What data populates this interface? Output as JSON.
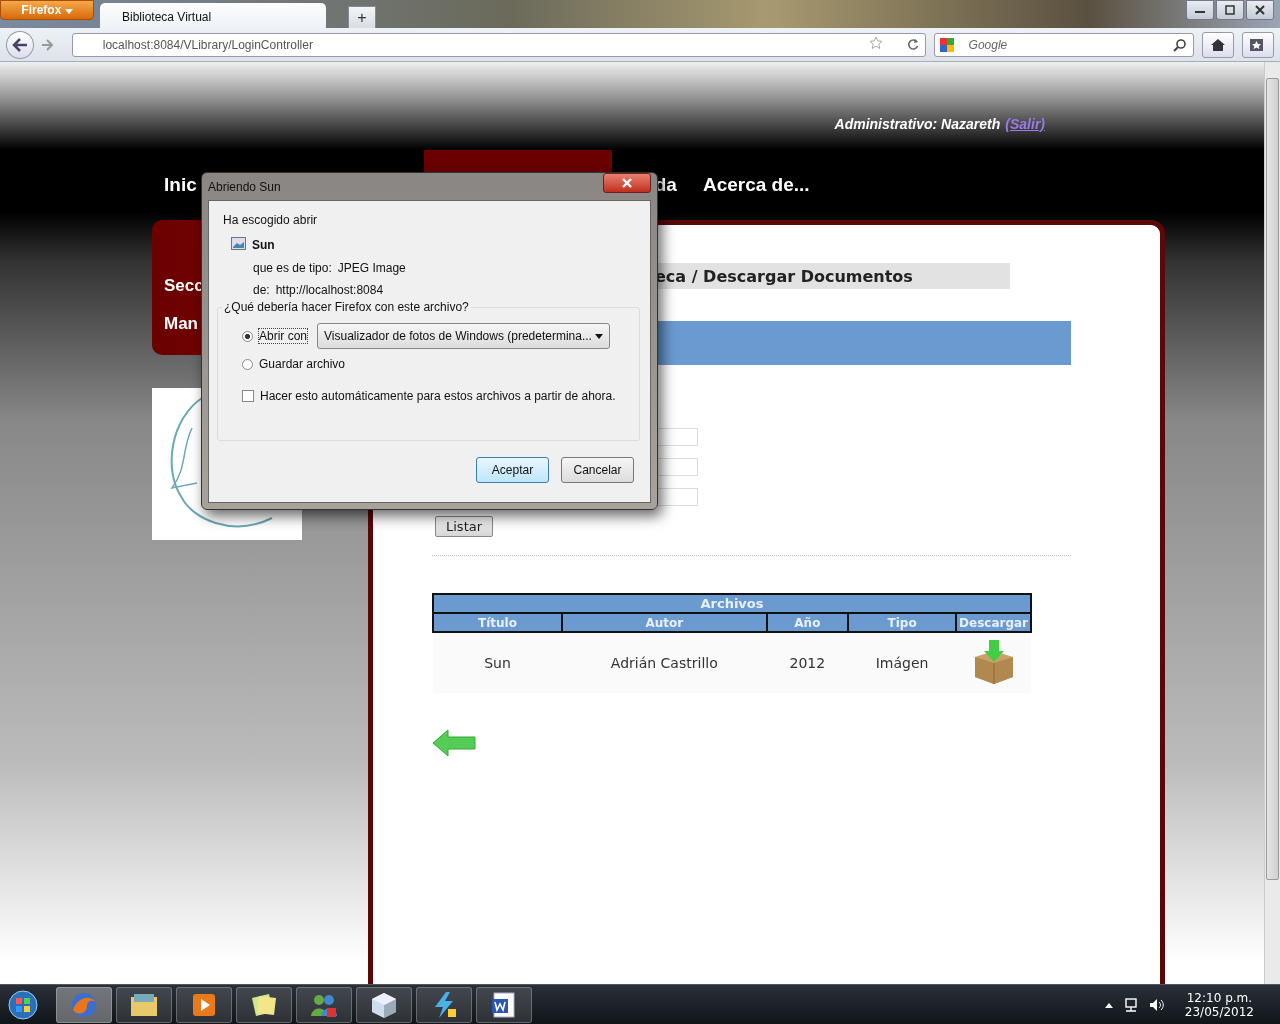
{
  "browser": {
    "menu_button": "Firefox",
    "tab_title": "Biblioteca Virtual",
    "new_tab": "+",
    "url": "localhost:8084/VLibrary/LoginController",
    "search_placeholder": "Google"
  },
  "header": {
    "user": "Administrativo: Nazareth",
    "logout": "(Salir)"
  },
  "nav": [
    {
      "label": "Inic"
    },
    {
      "label": "da"
    },
    {
      "label": "Acerca de..."
    }
  ],
  "sidebar": {
    "items": [
      "Secc",
      "Man"
    ]
  },
  "breadcrumb": "eca / Descargar Documentos",
  "list_button": "Listar",
  "table": {
    "caption": "Archivos",
    "columns": [
      "Título",
      "Autor",
      "Año",
      "Tipo",
      "Descargar"
    ],
    "rows": [
      [
        "Sun",
        "Adrián Castrillo",
        "2012",
        "Imágen"
      ]
    ]
  },
  "dialog": {
    "title": "Abriendo Sun",
    "intro": "Ha escogido abrir",
    "file_name": "Sun",
    "type_label": "que es de tipo:",
    "type": "JPEG Image",
    "from_label": "de:",
    "from": "http://localhost:8084",
    "question": "¿Qué debería hacer Firefox con este archivo?",
    "options": [
      {
        "label": "Abrir con",
        "selected": true
      },
      {
        "label": "Guardar archivo",
        "selected": false
      }
    ],
    "app_select": "Visualizador de fotos de Windows (predetermina...",
    "remember": {
      "label": "Hacer esto automáticamente para estos archivos a partir de ahora.",
      "checked": false
    },
    "buttons": [
      "Aceptar",
      "Cancelar"
    ]
  },
  "taskbar": {
    "time": "12:10 p.m.",
    "date": "23/05/2012"
  }
}
